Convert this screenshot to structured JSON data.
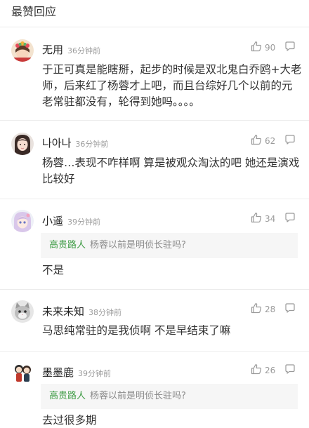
{
  "section_title": "最赞回应",
  "comments": [
    {
      "name": "无用",
      "time": "36分钟前",
      "likes": "90",
      "avatar_icon": "flower-crown-girl-avatar",
      "text": "于正可真是能瞎掰，起步的时候是双北鬼白乔鸥+大老师，后来红了杨蓉才上吧，而且台综好几个以前的元老常驻都没有，轮得到她吗。。。。"
    },
    {
      "name": "나아나",
      "time": "36分钟前",
      "likes": "62",
      "avatar_icon": "girl-photo-avatar",
      "text": "杨蓉…表现不咋样啊 算是被观众淘汰的吧 她还是演戏比较好"
    },
    {
      "name": "小遥",
      "time": "39分钟前",
      "likes": "34",
      "avatar_icon": "anime-girl-avatar",
      "quote": {
        "name": "高贵路人",
        "text": "杨蓉以前是明侦长驻吗?"
      },
      "text": "不是"
    },
    {
      "name": "未来未知",
      "time": "38分钟前",
      "likes": "28",
      "avatar_icon": "cat-avatar",
      "text": "马思纯常驻的是我侦啊 不是早结束了嘛"
    },
    {
      "name": "墨墨鹿",
      "time": "39分钟前",
      "likes": "26",
      "avatar_icon": "cartoon-couple-avatar",
      "quote": {
        "name": "高贵路人",
        "text": "杨蓉以前是明侦长驻吗?"
      },
      "text": "去过很多期"
    }
  ],
  "colors": {
    "quote_name": "#3f9c45",
    "meta_gray": "#9c9c9c",
    "quote_bg": "#f6f6f6"
  }
}
